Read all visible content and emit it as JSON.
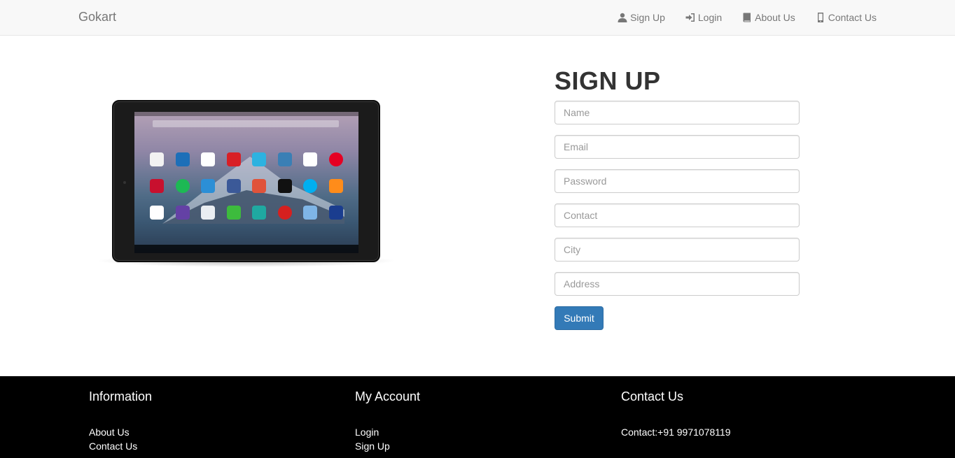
{
  "brand": "Gokart",
  "nav": {
    "items": [
      {
        "label": "Sign Up",
        "icon": "user-icon"
      },
      {
        "label": "Login",
        "icon": "login-icon"
      },
      {
        "label": "About Us",
        "icon": "book-icon"
      },
      {
        "label": "Contact Us",
        "icon": "phone-icon"
      }
    ]
  },
  "form": {
    "title": "SIGN UP",
    "fields": [
      {
        "placeholder": "Name",
        "value": ""
      },
      {
        "placeholder": "Email",
        "value": ""
      },
      {
        "placeholder": "Password",
        "value": ""
      },
      {
        "placeholder": "Contact",
        "value": ""
      },
      {
        "placeholder": "City",
        "value": ""
      },
      {
        "placeholder": "Address",
        "value": ""
      }
    ],
    "submit_label": "Submit"
  },
  "footer": {
    "information": {
      "title": "Information",
      "links": [
        "About Us",
        "Contact Us"
      ]
    },
    "account": {
      "title": "My Account",
      "links": [
        "Login",
        "Sign Up"
      ]
    },
    "contact": {
      "title": "Contact Us",
      "lines": [
        "Contact:+91 9971078119"
      ]
    }
  },
  "colors": {
    "navbar_bg": "#f8f8f8",
    "primary": "#337ab7",
    "footer_bg": "#000000",
    "text": "#333333"
  }
}
